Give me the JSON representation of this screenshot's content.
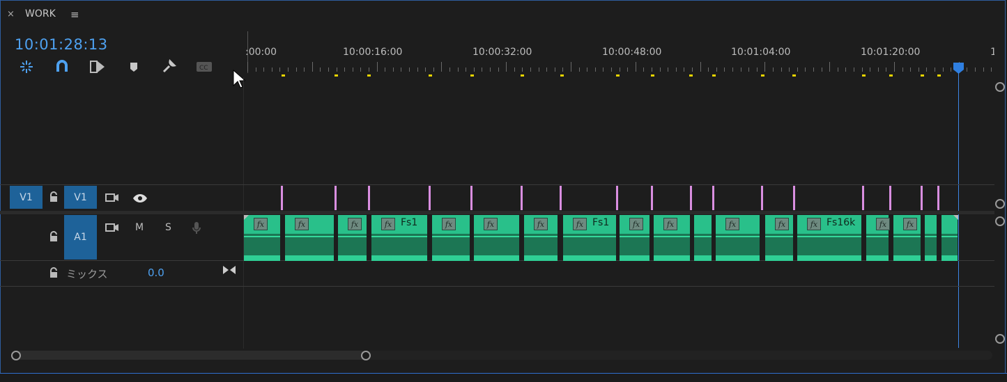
{
  "panel": {
    "title": "WORK",
    "close_glyph": "×",
    "menu_glyph": "≡"
  },
  "timecode": "10:01:28:13",
  "toolbar": {
    "icons": [
      "snap-icon",
      "linked-selection-icon",
      "insert-overwrite-icon",
      "marker-icon",
      "wrench-icon",
      "captions-icon"
    ]
  },
  "ruler": {
    "labels": [
      ":00:00",
      "10:00:16:00",
      "10:00:32:00",
      "10:00:48:00",
      "10:01:04:00",
      "10:01:20:00",
      "1"
    ]
  },
  "tracks": {
    "v1": {
      "source_label": "V1",
      "target_label": "V1"
    },
    "a1": {
      "target_label": "A1",
      "mute_label": "M",
      "solo_label": "S"
    },
    "mix": {
      "label": "ミックス",
      "value": "0.0"
    }
  },
  "clips": [
    {
      "name": ""
    },
    {
      "name": ""
    },
    {
      "name": ""
    },
    {
      "name": "Fs1"
    },
    {
      "name": ""
    },
    {
      "name": ""
    },
    {
      "name": ""
    },
    {
      "name": "Fs1"
    },
    {
      "name": ""
    },
    {
      "name": ""
    },
    {
      "name": ""
    },
    {
      "name": ""
    },
    {
      "name": ""
    },
    {
      "name": "Fs16k"
    },
    {
      "name": ""
    },
    {
      "name": ""
    },
    {
      "name": ""
    },
    {
      "name": ""
    }
  ],
  "colors": {
    "accent": "#4ea1f0",
    "clip": "#29c08a",
    "video_marker": "#d98ee0",
    "ruler_marker": "#e8d400",
    "track_button": "#1e6299"
  }
}
